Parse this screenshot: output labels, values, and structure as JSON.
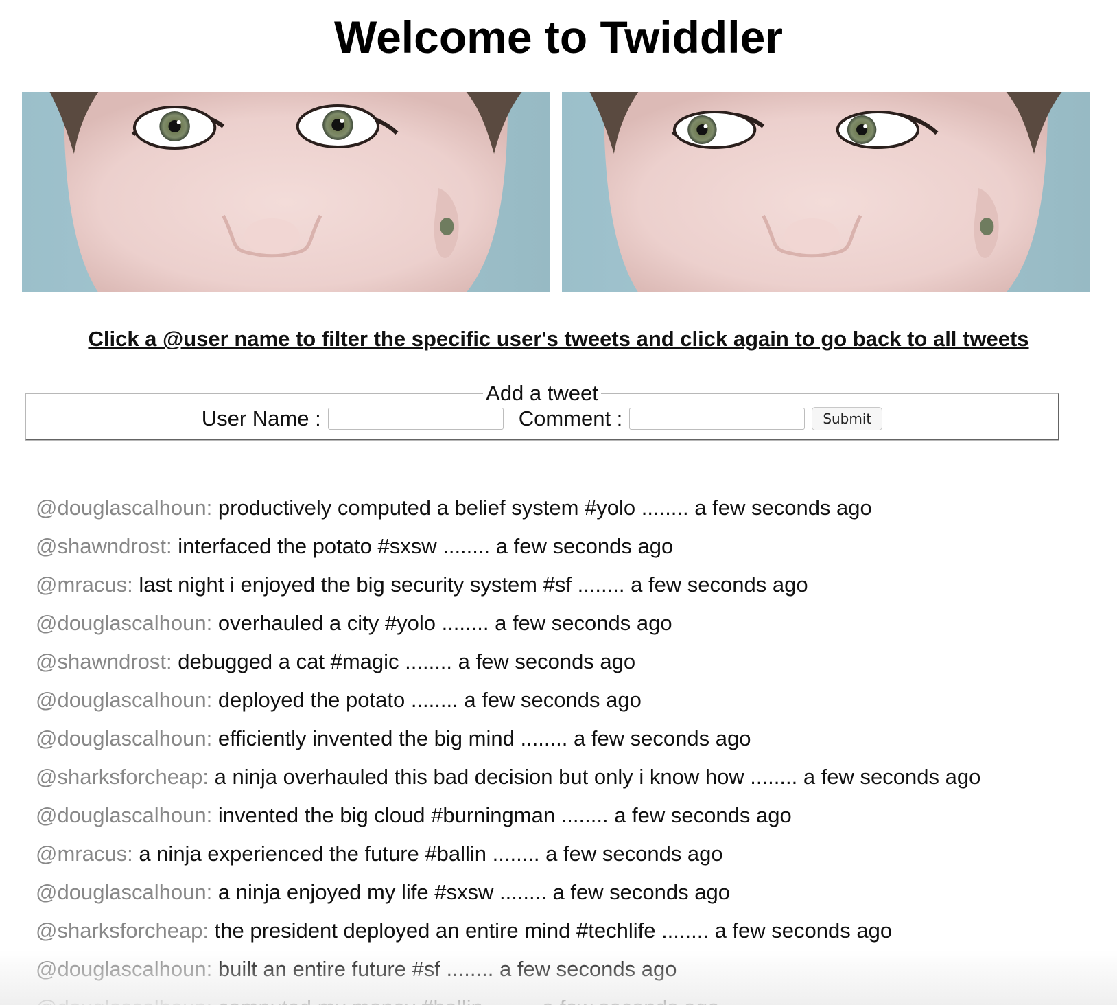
{
  "header": {
    "title": "Welcome to Twiddler"
  },
  "banner": {
    "images": [
      {
        "icon": "face-eyes-forward-image"
      },
      {
        "icon": "face-eyes-sideways-image"
      }
    ]
  },
  "instructions": {
    "text": "Click a @user name to filter the specific user's tweets and click again to go back to all tweets"
  },
  "form": {
    "legend": "Add a tweet",
    "username_label": "User Name :",
    "username_value": "",
    "comment_label": "Comment :",
    "comment_value": "",
    "submit_label": "Submit"
  },
  "tweets": [
    {
      "user": "@douglascalhoun:",
      "message": " productively computed a belief system #yolo ........ a few seconds ago"
    },
    {
      "user": "@shawndrost:",
      "message": " interfaced the potato #sxsw ........ a few seconds ago"
    },
    {
      "user": "@mracus:",
      "message": " last night i enjoyed the big security system #sf ........ a few seconds ago"
    },
    {
      "user": "@douglascalhoun:",
      "message": " overhauled a city #yolo ........ a few seconds ago"
    },
    {
      "user": "@shawndrost:",
      "message": " debugged a cat #magic ........ a few seconds ago"
    },
    {
      "user": "@douglascalhoun:",
      "message": " deployed the potato ........ a few seconds ago"
    },
    {
      "user": "@douglascalhoun:",
      "message": " efficiently invented the big mind ........ a few seconds ago"
    },
    {
      "user": "@sharksforcheap:",
      "message": " a ninja overhauled this bad decision but only i know how ........ a few seconds ago"
    },
    {
      "user": "@douglascalhoun:",
      "message": " invented the big cloud #burningman ........ a few seconds ago"
    },
    {
      "user": "@mracus:",
      "message": " a ninja experienced the future #ballin ........ a few seconds ago"
    },
    {
      "user": "@douglascalhoun:",
      "message": " a ninja enjoyed my life #sxsw ........ a few seconds ago"
    },
    {
      "user": "@sharksforcheap:",
      "message": " the president deployed an entire mind #techlife ........ a few seconds ago"
    },
    {
      "user": "@douglascalhoun:",
      "message": " built an entire future #sf ........ a few seconds ago"
    },
    {
      "user": "@douglascalhoun:",
      "message": " computed my money #ballin ........ a few seconds ago"
    }
  ]
}
